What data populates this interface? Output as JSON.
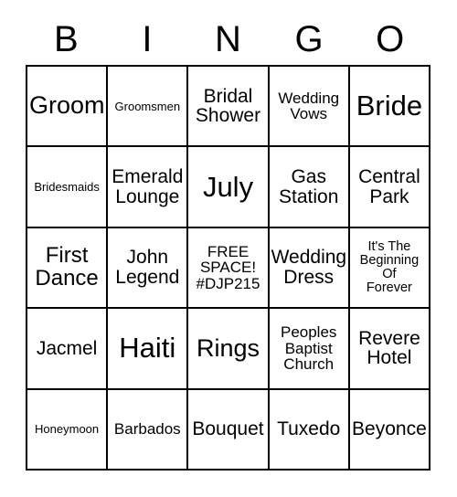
{
  "card": {
    "header_letters": [
      "B",
      "I",
      "N",
      "G",
      "O"
    ],
    "rows": [
      [
        {
          "text": "Groom",
          "size": "fs-xl"
        },
        {
          "text": "Groomsmen",
          "size": "fs-xxs"
        },
        {
          "text": "Bridal\nShower",
          "size": "fs-md"
        },
        {
          "text": "Wedding\nVows",
          "size": "fs-sm"
        },
        {
          "text": "Bride",
          "size": "fs-xxl"
        }
      ],
      [
        {
          "text": "Bridesmaids",
          "size": "fs-xxs"
        },
        {
          "text": "Emerald\nLounge",
          "size": "fs-md"
        },
        {
          "text": "July",
          "size": "fs-xxl"
        },
        {
          "text": "Gas\nStation",
          "size": "fs-md"
        },
        {
          "text": "Central\nPark",
          "size": "fs-md"
        }
      ],
      [
        {
          "text": "First\nDance",
          "size": "fs-lg"
        },
        {
          "text": "John\nLegend",
          "size": "fs-md"
        },
        {
          "text": "FREE\nSPACE!\n#DJP215",
          "size": "fs-sm"
        },
        {
          "text": "Wedding\nDress",
          "size": "fs-md"
        },
        {
          "text": "It's The\nBeginning\nOf\nForever",
          "size": "fs-xs"
        }
      ],
      [
        {
          "text": "Jacmel",
          "size": "fs-md"
        },
        {
          "text": "Haiti",
          "size": "fs-xxl"
        },
        {
          "text": "Rings",
          "size": "fs-xl"
        },
        {
          "text": "Peoples\nBaptist\nChurch",
          "size": "fs-sm"
        },
        {
          "text": "Revere\nHotel",
          "size": "fs-md"
        }
      ],
      [
        {
          "text": "Honeymoon",
          "size": "fs-xxs"
        },
        {
          "text": "Barbados",
          "size": "fs-sm"
        },
        {
          "text": "Bouquet",
          "size": "fs-md"
        },
        {
          "text": "Tuxedo",
          "size": "fs-md"
        },
        {
          "text": "Beyonce",
          "size": "fs-md"
        }
      ]
    ]
  },
  "colors": {
    "grid_line": "#000000",
    "text": "#000000",
    "background": "#ffffff"
  }
}
